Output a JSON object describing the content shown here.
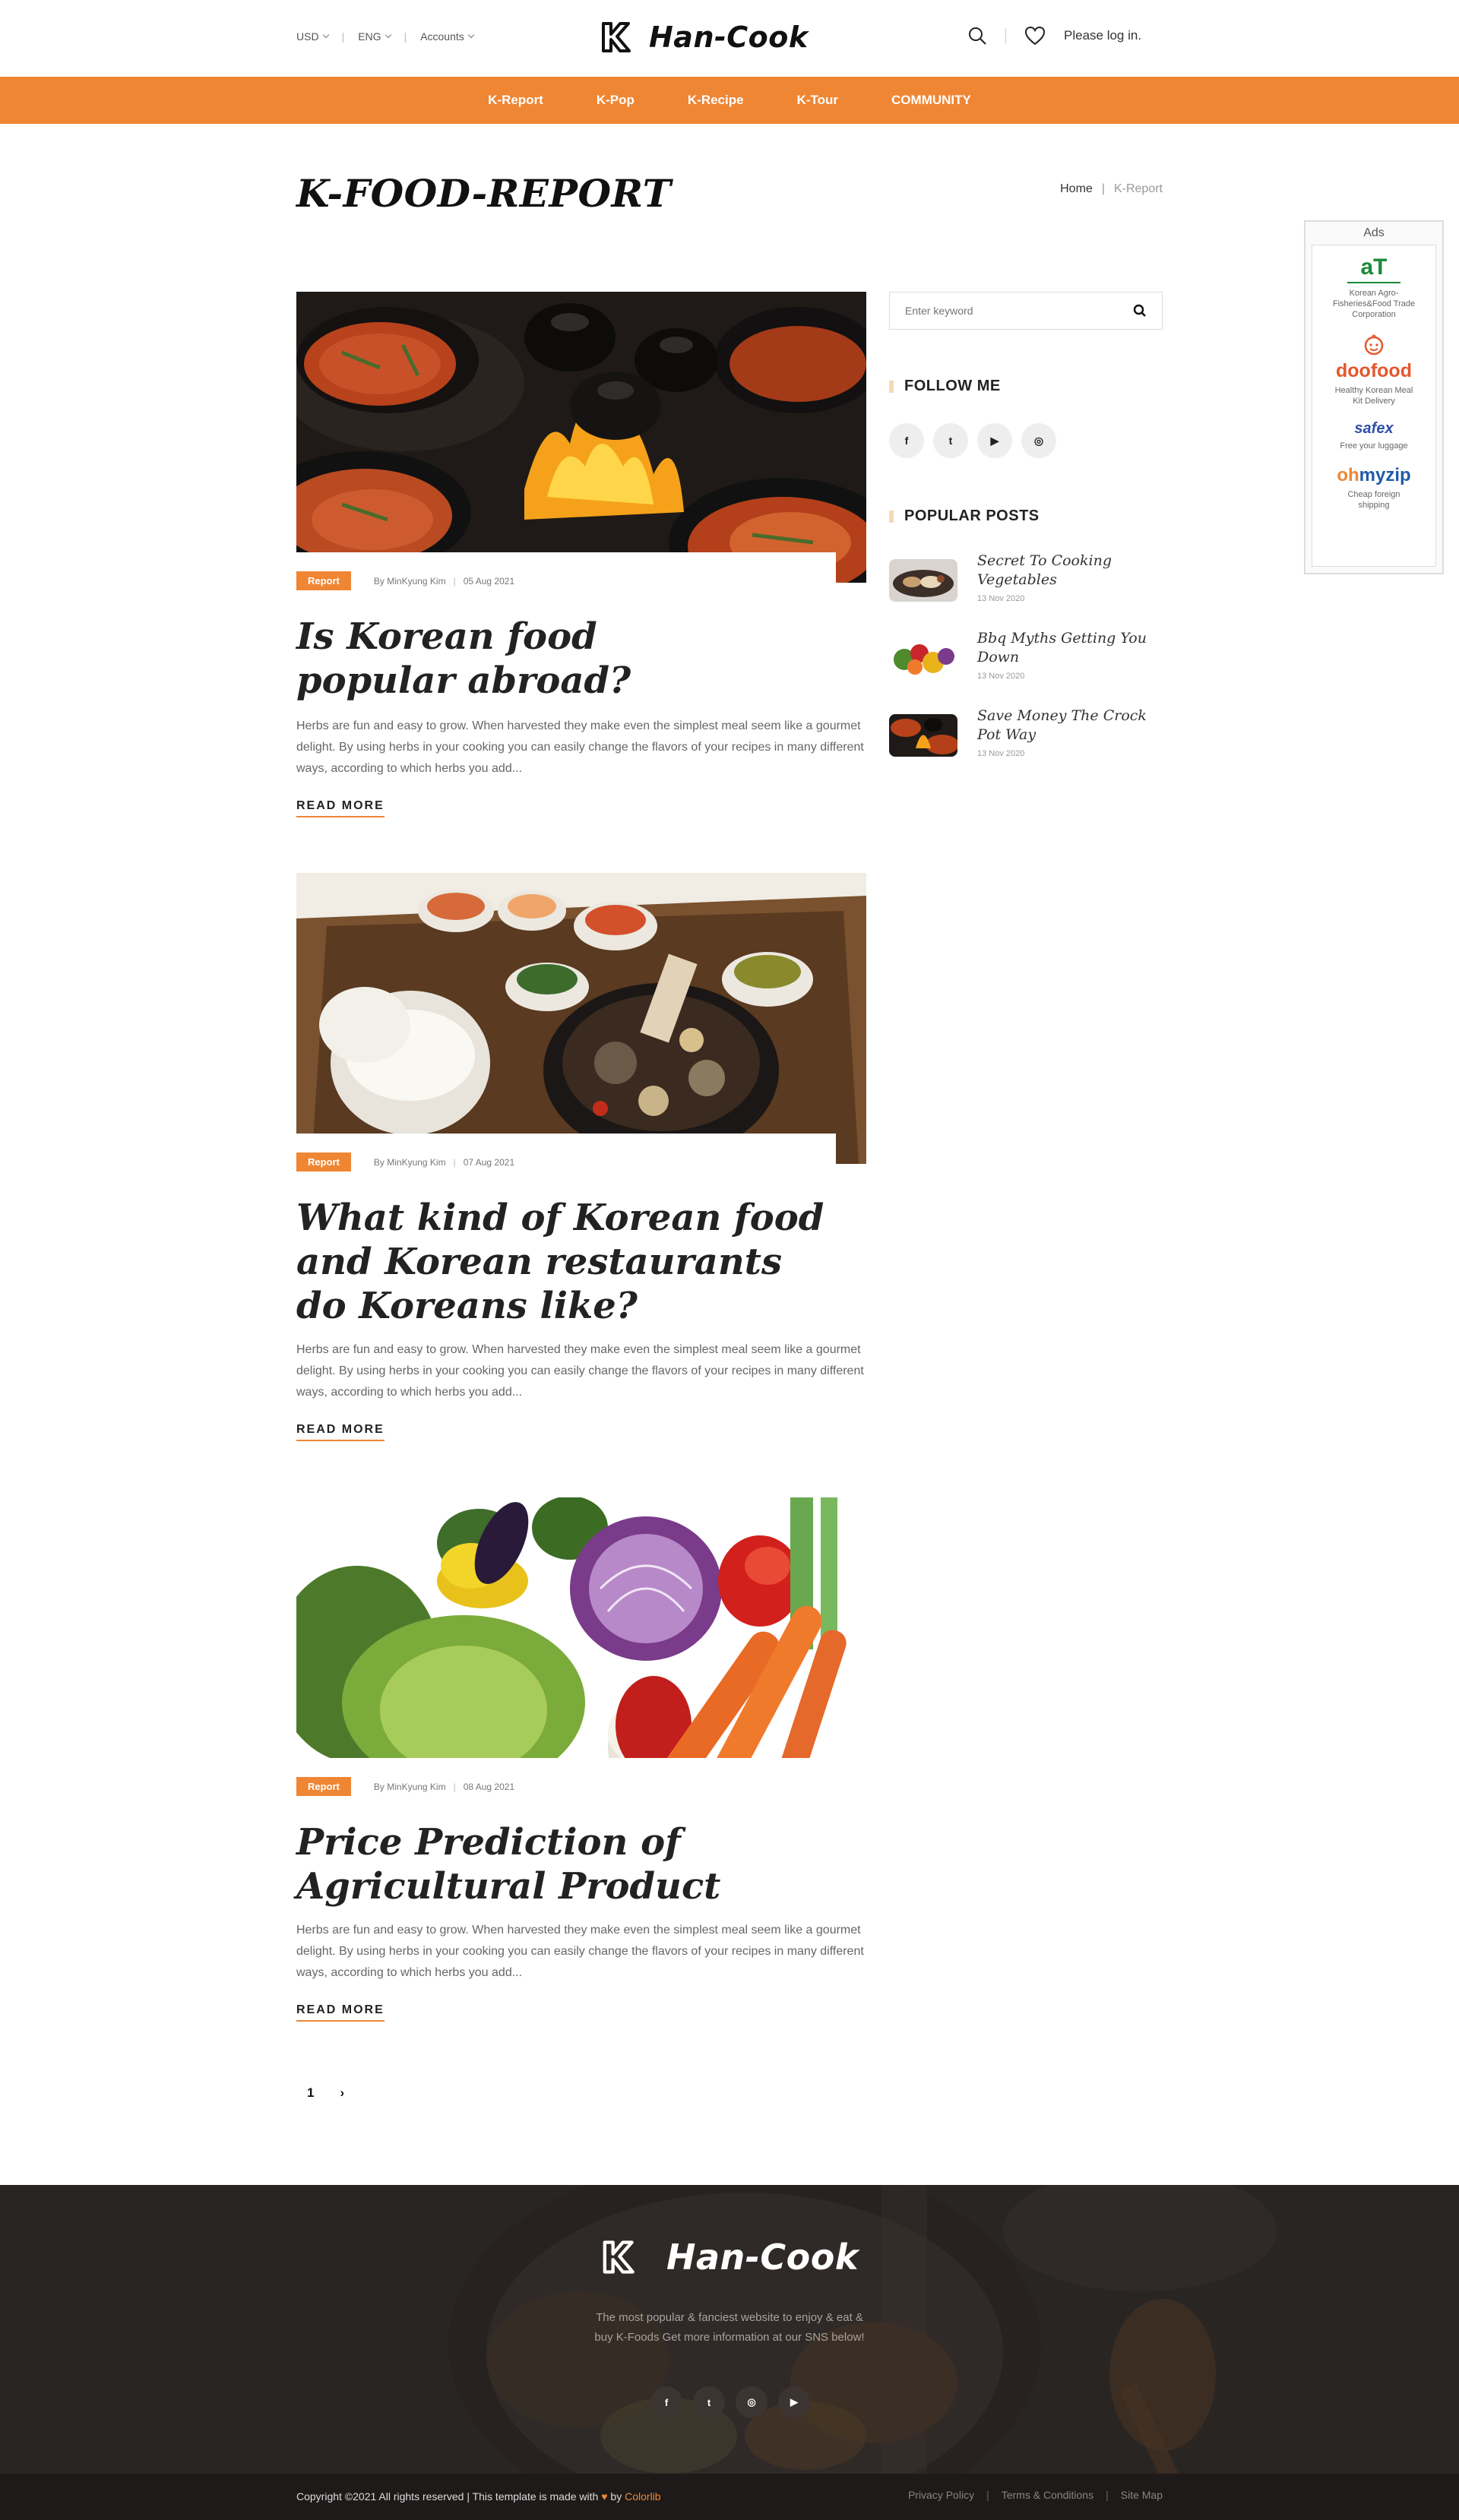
{
  "header": {
    "currency": "USD",
    "language": "ENG",
    "accounts": "Accounts",
    "brand": "Han-Cook",
    "login": "Please log in."
  },
  "nav": [
    "K-Report",
    "K-Pop",
    "K-Recipe",
    "K-Tour",
    "COMMUNITY"
  ],
  "page": {
    "title": "K-FOOD-REPORT",
    "breadcrumb_home": "Home",
    "breadcrumb_sep": "|",
    "breadcrumb_current": "K-Report"
  },
  "ads": {
    "title": "Ads",
    "items": [
      {
        "logo": "aT",
        "desc": "Korean Agro-Fisheries&Food Trade Corporation"
      },
      {
        "logo": "doofood",
        "desc": "Healthy Korean Meal Kit Delivery"
      },
      {
        "logo": "safex",
        "desc": "Free your luggage"
      },
      {
        "logo_a": "oh",
        "logo_b": "myzip",
        "desc": "Cheap foreign shipping"
      }
    ]
  },
  "articles": [
    {
      "badge": "Report",
      "author": "By MinKyung Kim",
      "date": "05 Aug 2021",
      "title": "Is Korean food popular abroad?",
      "excerpt": "Herbs are fun and easy to grow. When harvested they make even the simplest meal seem like a gourmet delight. By using herbs in your cooking you can easily change the flavors of your recipes in many different ways, according to which herbs you add...",
      "read_more": "READ MORE"
    },
    {
      "badge": "Report",
      "author": "By MinKyung Kim",
      "date": "07 Aug 2021",
      "title": "What kind of Korean food and Korean restaurants do Koreans like?",
      "excerpt": "Herbs are fun and easy to grow. When harvested they make even the simplest meal seem like a gourmet delight. By using herbs in your cooking you can easily change the flavors of your recipes in many different ways, according to which herbs you add...",
      "read_more": "READ MORE"
    },
    {
      "badge": "Report",
      "author": "By MinKyung Kim",
      "date": "08 Aug 2021",
      "title": "Price Prediction of Agricultural Product",
      "excerpt": "Herbs are fun and easy to grow. When harvested they make even the simplest meal seem like a gourmet delight. By using herbs in your cooking you can easily change the flavors of your recipes in many different ways, according to which herbs you add...",
      "read_more": "READ MORE"
    }
  ],
  "sidebar": {
    "search_placeholder": "Enter keyword",
    "follow_title": "FOLLOW ME",
    "socials": [
      "f",
      "t",
      "▶",
      "◎"
    ],
    "popular_title": "POPULAR POSTS",
    "posts": [
      {
        "title": "Secret To Cooking Vegetables",
        "date": "13 Nov 2020"
      },
      {
        "title": "Bbq Myths Getting You Down",
        "date": "13 Nov 2020"
      },
      {
        "title": "Save Money The Crock Pot Way",
        "date": "13 Nov 2020"
      }
    ]
  },
  "pagination": {
    "current": "1",
    "next": "›"
  },
  "footer": {
    "brand": "Han-Cook",
    "description": "The most popular & fanciest website to enjoy & eat & buy K-Foods Get more information at our SNS below!",
    "socials": [
      "f",
      "t",
      "◎",
      "▶"
    ],
    "copyright_pre": "Copyright ©2021 All rights reserved | This template is made with",
    "heart": "♥",
    "by": "by",
    "credit": "Colorlib",
    "legal": [
      "Privacy Policy",
      "Terms & Conditions",
      "Site Map"
    ]
  },
  "colors": {
    "accent": "#ef8634",
    "footer_bg": "#3a3230",
    "bottom_bar": "#1d1a19"
  },
  "icons": [
    "search-icon",
    "heart-icon",
    "facebook-icon",
    "twitter-icon",
    "youtube-icon",
    "instagram-icon",
    "chevron-right-icon"
  ]
}
